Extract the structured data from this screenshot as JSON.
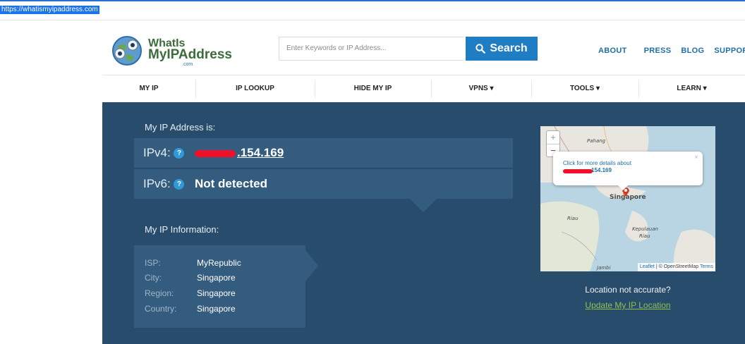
{
  "url_bar": {
    "url": "https://whatismyipaddress.com"
  },
  "logo": {
    "line1": "WhatIs",
    "line2": "MyIPAddress",
    "line3": ".com"
  },
  "search": {
    "placeholder": "Enter Keywords or IP Address...",
    "button_label": "Search"
  },
  "top_nav": [
    "ABOUT",
    "PRESS",
    "BLOG",
    "SUPPORT"
  ],
  "main_nav": [
    "MY IP",
    "IP LOOKUP",
    "HIDE MY IP",
    "VPNS ▾",
    "TOOLS ▾",
    "LEARN ▾"
  ],
  "ip": {
    "heading": "My IP Address is:",
    "ipv4_label": "IPv4:",
    "ipv4_value_visible": ".154.169",
    "ipv6_label": "IPv6:",
    "ipv6_value": "Not detected",
    "help_glyph": "?"
  },
  "info": {
    "heading": "My IP Information:",
    "rows": [
      {
        "key": "ISP:",
        "value": "MyRepublic"
      },
      {
        "key": "City:",
        "value": "Singapore"
      },
      {
        "key": "Region:",
        "value": "Singapore"
      },
      {
        "key": "Country:",
        "value": "Singapore"
      }
    ]
  },
  "map": {
    "zoom_in": "+",
    "zoom_out": "−",
    "popup_text": "Click for more details about",
    "popup_ip_visible": "154.169",
    "popup_close": "×",
    "labels": {
      "pahang": "Pahang",
      "singapore": "Singapore",
      "riau": "Riau",
      "kepulauan": "Kepulauan",
      "kepulauan2": "Riau",
      "jambi": "Jambi"
    },
    "attribution_leaflet": "Leaflet",
    "attribution_sep": " | © OpenStreetMap ",
    "attribution_terms": "Terms"
  },
  "location": {
    "not_accurate": "Location not accurate?",
    "update_link": "Update My IP Location"
  },
  "colors": {
    "hero_bg": "#284d6c",
    "panel_bg": "#335c7e",
    "accent_blue": "#1f7dc3",
    "link_green": "#8fc04a",
    "redaction": "#f0102a"
  }
}
